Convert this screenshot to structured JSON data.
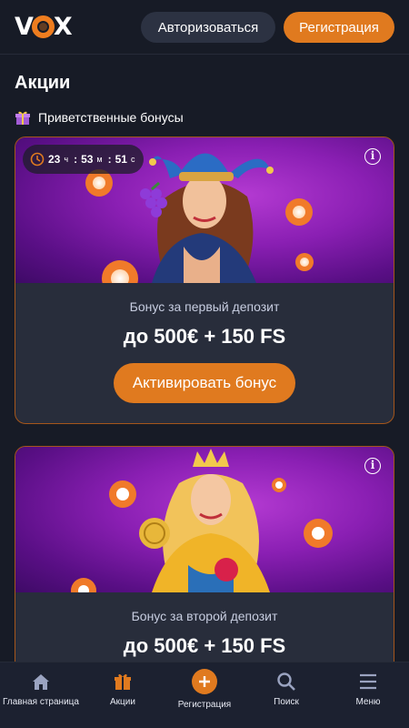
{
  "header": {
    "logo_text": "VOX",
    "login_label": "Авторизоваться",
    "register_label": "Регистрация"
  },
  "page": {
    "title": "Акции",
    "section_title": "Приветственные бонусы"
  },
  "cards": [
    {
      "timer": {
        "hours": "23",
        "hours_unit": "ч",
        "minutes": "53",
        "minutes_unit": "м",
        "seconds": "51",
        "seconds_unit": "с"
      },
      "label": "Бонус за первый депозит",
      "amount": "до 500€ + 150 FS",
      "button": "Активировать бонус"
    },
    {
      "label": "Бонус за второй депозит",
      "amount": "до 500€ + 150 FS"
    }
  ],
  "bottom_nav": [
    {
      "label": "Главная страница",
      "icon": "home-icon"
    },
    {
      "label": "Акции",
      "icon": "gift-icon"
    },
    {
      "label": "Регистрация",
      "icon": "plus-icon"
    },
    {
      "label": "Поиск",
      "icon": "search-icon"
    },
    {
      "label": "Меню",
      "icon": "menu-icon"
    }
  ],
  "colors": {
    "background": "#171b26",
    "accent": "#e07a1f",
    "card": "#282d3b",
    "banner_purple": "#8a1fb3"
  }
}
